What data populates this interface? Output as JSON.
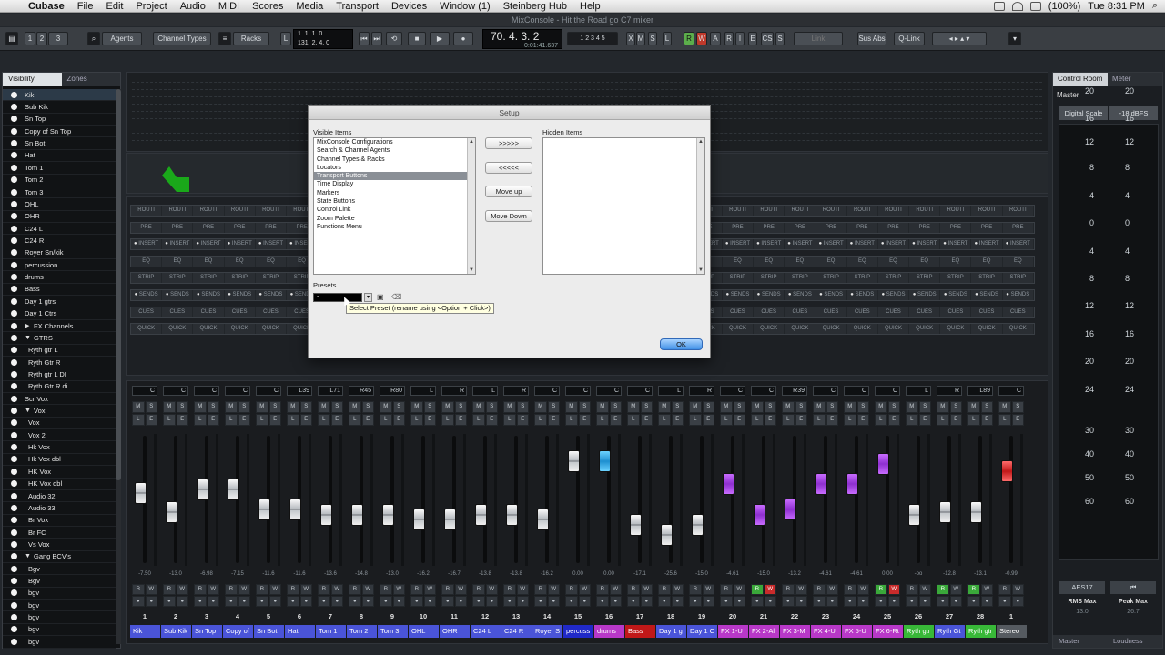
{
  "menubar": {
    "app": "Cubase",
    "items": [
      "File",
      "Edit",
      "Project",
      "Audio",
      "MIDI",
      "Scores",
      "Media",
      "Transport",
      "Devices",
      "Window (1)",
      "Steinberg Hub",
      "Help"
    ],
    "battery": "(100%)",
    "clock": "Tue 8:31 PM"
  },
  "window_title": "MixConsole - Hit the Road go C7 mixer",
  "toolbar": {
    "btn1": "1",
    "btn2": "2",
    "btn3": "3",
    "agents": "Agents",
    "channel_types": "Channel Types",
    "racks": "Racks",
    "time_line1": "1. 1. 1. 0",
    "time_line2": "131. 2. 4. 0",
    "position": "70. 4. 3. 2",
    "position_sub": "0:01:41.637",
    "sig": "1 2 3 4 5",
    "letters_a": [
      "X",
      "M",
      "S",
      "L"
    ],
    "letters_b": [
      "R",
      "W",
      "A"
    ],
    "letters_c": [
      "R",
      "I",
      "E",
      "CS",
      "S"
    ],
    "link": "Link",
    "sus_abs": "Sus Abs",
    "qlink": "Q-Link"
  },
  "left_panel": {
    "tabs": [
      "Visibility",
      "Zones"
    ],
    "items": [
      {
        "label": "Kik",
        "indent": 0,
        "sel": true
      },
      {
        "label": "Sub Kik",
        "indent": 0
      },
      {
        "label": "Sn Top",
        "indent": 0
      },
      {
        "label": "Copy of Sn Top",
        "indent": 0
      },
      {
        "label": "Sn Bot",
        "indent": 0
      },
      {
        "label": "Hat",
        "indent": 0
      },
      {
        "label": "Tom 1",
        "indent": 0
      },
      {
        "label": "Tom 2",
        "indent": 0
      },
      {
        "label": "Tom 3",
        "indent": 0
      },
      {
        "label": "OHL",
        "indent": 0
      },
      {
        "label": "OHR",
        "indent": 0
      },
      {
        "label": "C24 L",
        "indent": 0
      },
      {
        "label": "C24 R",
        "indent": 0
      },
      {
        "label": "Royer Sn/kik",
        "indent": 0
      },
      {
        "label": "percussion",
        "indent": 0
      },
      {
        "label": "drums",
        "indent": 0
      },
      {
        "label": "Bass",
        "indent": 0
      },
      {
        "label": "Day 1 gtrs",
        "indent": 0
      },
      {
        "label": "Day 1 Ctrs",
        "indent": 0
      },
      {
        "label": "FX Channels",
        "indent": 0,
        "folder": "closed"
      },
      {
        "label": "GTRS",
        "indent": 0,
        "folder": "open"
      },
      {
        "label": "Ryth gtr L",
        "indent": 1
      },
      {
        "label": "Ryth Gtr R",
        "indent": 1
      },
      {
        "label": "Ryth gtr L DI",
        "indent": 1
      },
      {
        "label": "Ryth Gtr R di",
        "indent": 1
      },
      {
        "label": "Scr Vox",
        "indent": 0
      },
      {
        "label": "Vox",
        "indent": 0,
        "folder": "open"
      },
      {
        "label": "Vox",
        "indent": 1
      },
      {
        "label": "Vox 2",
        "indent": 1
      },
      {
        "label": "Hk Vox",
        "indent": 1
      },
      {
        "label": "Hk Vox dbl",
        "indent": 1
      },
      {
        "label": "HK Vox",
        "indent": 1
      },
      {
        "label": "HK Vox dbl",
        "indent": 1
      },
      {
        "label": "Audio 32",
        "indent": 1
      },
      {
        "label": "Audio 33",
        "indent": 1
      },
      {
        "label": "Br Vox",
        "indent": 1
      },
      {
        "label": "Br FC",
        "indent": 1
      },
      {
        "label": "Vs Vox",
        "indent": 1
      },
      {
        "label": "Gang BCV's",
        "indent": 0,
        "folder": "open"
      },
      {
        "label": "Bgv",
        "indent": 1
      },
      {
        "label": "Bgv",
        "indent": 1
      },
      {
        "label": "bgv",
        "indent": 1
      },
      {
        "label": "bgv",
        "indent": 1
      },
      {
        "label": "bgv",
        "indent": 1
      },
      {
        "label": "bgv",
        "indent": 1
      },
      {
        "label": "bgv",
        "indent": 1
      }
    ]
  },
  "racks": {
    "rows": [
      {
        "label": "ROUTI",
        "on": false
      },
      {
        "label": "PRE",
        "on": false
      },
      {
        "label": "INSERT",
        "on": true
      },
      {
        "label": "EQ",
        "on": false
      },
      {
        "label": "STRIP",
        "on": false
      },
      {
        "label": "SENDS",
        "on": true
      },
      {
        "label": "CUES",
        "on": false
      },
      {
        "label": "QUICK",
        "on": false
      }
    ]
  },
  "dialog": {
    "title": "Setup",
    "visible_label": "Visible Items",
    "hidden_label": "Hidden Items",
    "visible_items": [
      "MixConsole Configurations",
      "Search & Channel Agents",
      "Channel Types & Racks",
      "Locators",
      "Transport Buttons",
      "Time Display",
      "Markers",
      "State Buttons",
      "Control Link",
      "Zoom Palette",
      "Functions Menu"
    ],
    "selected_index": 4,
    "btn_right": ">>>>>",
    "btn_left": "<<<<<",
    "btn_up": "Move up",
    "btn_down": "Move Down",
    "presets_label": "Presets",
    "preset_value": "-",
    "ok": "OK",
    "tooltip": "Select Preset (rename using <Option + Click>)"
  },
  "channels": [
    {
      "num": "1",
      "name": "Kik",
      "color": "#4a54d8",
      "pan": "C",
      "db": "-7.50",
      "fader": 0.55,
      "style": "white"
    },
    {
      "num": "2",
      "name": "Sub Kik",
      "color": "#4a54d8",
      "pan": "C",
      "db": "-13.0",
      "fader": 0.4,
      "style": "white"
    },
    {
      "num": "3",
      "name": "Sn Top",
      "color": "#4a54d8",
      "pan": "C",
      "db": "-6.98",
      "fader": 0.58,
      "style": "white"
    },
    {
      "num": "4",
      "name": "Copy of",
      "color": "#4a54d8",
      "pan": "C",
      "db": "-7.15",
      "fader": 0.58,
      "style": "white"
    },
    {
      "num": "5",
      "name": "Sn Bot",
      "color": "#4a54d8",
      "pan": "C",
      "db": "-11.6",
      "fader": 0.42,
      "style": "white"
    },
    {
      "num": "6",
      "name": "Hat",
      "color": "#4a54d8",
      "pan": "L39",
      "db": "-11.6",
      "fader": 0.42,
      "style": "white"
    },
    {
      "num": "7",
      "name": "Tom 1",
      "color": "#4a54d8",
      "pan": "L71",
      "db": "-13.6",
      "fader": 0.38,
      "style": "white"
    },
    {
      "num": "8",
      "name": "Tom 2",
      "color": "#4a54d8",
      "pan": "R45",
      "db": "-14.8",
      "fader": 0.38,
      "style": "white"
    },
    {
      "num": "9",
      "name": "Tom 3",
      "color": "#4a54d8",
      "pan": "R80",
      "db": "-13.0",
      "fader": 0.38,
      "style": "white"
    },
    {
      "num": "10",
      "name": "OHL",
      "color": "#4a54d8",
      "pan": "L",
      "db": "-16.2",
      "fader": 0.34,
      "style": "white"
    },
    {
      "num": "11",
      "name": "OHR",
      "color": "#4a54d8",
      "pan": "R",
      "db": "-16.7",
      "fader": 0.34,
      "style": "white"
    },
    {
      "num": "12",
      "name": "C24 L",
      "color": "#4a54d8",
      "pan": "L",
      "db": "-13.8",
      "fader": 0.38,
      "style": "white"
    },
    {
      "num": "13",
      "name": "C24 R",
      "color": "#4a54d8",
      "pan": "R",
      "db": "-13.8",
      "fader": 0.38,
      "style": "white"
    },
    {
      "num": "14",
      "name": "Royer S",
      "color": "#4a54d8",
      "pan": "C",
      "db": "-16.2",
      "fader": 0.34,
      "style": "white"
    },
    {
      "num": "15",
      "name": "percuss",
      "color": "#2029c8",
      "pan": "C",
      "db": "0.00",
      "fader": 0.8,
      "style": "white"
    },
    {
      "num": "16",
      "name": "drums",
      "color": "#b838c8",
      "pan": "C",
      "db": "0.00",
      "fader": 0.8,
      "style": "blue"
    },
    {
      "num": "17",
      "name": "Bass",
      "color": "#c01818",
      "pan": "C",
      "db": "-17.1",
      "fader": 0.3,
      "style": "white"
    },
    {
      "num": "18",
      "name": "Day 1 g",
      "color": "#4a54d8",
      "pan": "L",
      "db": "-25.6",
      "fader": 0.22,
      "style": "white"
    },
    {
      "num": "19",
      "name": "Day 1 C",
      "color": "#4a54d8",
      "pan": "R",
      "db": "-15.0",
      "fader": 0.3,
      "style": "white"
    },
    {
      "num": "20",
      "name": "FX 1-U",
      "color": "#b838c8",
      "pan": "C",
      "db": "-4.61",
      "fader": 0.62,
      "style": "purple"
    },
    {
      "num": "21",
      "name": "FX 2-Al",
      "color": "#b838c8",
      "pan": "C",
      "db": "-15.0",
      "fader": 0.38,
      "style": "purple"
    },
    {
      "num": "22",
      "name": "FX 3-M",
      "color": "#b838c8",
      "pan": "R39",
      "db": "-13.2",
      "fader": 0.42,
      "style": "purple"
    },
    {
      "num": "23",
      "name": "FX 4-U",
      "color": "#b838c8",
      "pan": "C",
      "db": "-4.61",
      "fader": 0.62,
      "style": "purple"
    },
    {
      "num": "24",
      "name": "FX 5-U",
      "color": "#b838c8",
      "pan": "C",
      "db": "-4.61",
      "fader": 0.62,
      "style": "purple"
    },
    {
      "num": "25",
      "name": "FX 6-Rt",
      "color": "#b838c8",
      "pan": "C",
      "db": "0.00",
      "fader": 0.78,
      "style": "purple"
    },
    {
      "num": "26",
      "name": "Ryth gtr",
      "color": "#38b838",
      "pan": "L",
      "db": "-oo",
      "fader": 0.38,
      "style": "white"
    },
    {
      "num": "27",
      "name": "Ryth Gt",
      "color": "#4a54d8",
      "pan": "R",
      "db": "-12.8",
      "fader": 0.4,
      "style": "white"
    },
    {
      "num": "28",
      "name": "Ryth gtr",
      "color": "#38b838",
      "pan": "L89",
      "db": "-13.1",
      "fader": 0.4,
      "style": "white"
    },
    {
      "num": "1",
      "name": "Stereo",
      "color": "#555a60",
      "pan": "C",
      "db": "-0.99",
      "fader": 0.72,
      "style": "red"
    }
  ],
  "right_panel": {
    "tabs": [
      "Control Room",
      "Meter"
    ],
    "master": "Master",
    "digital_scale": "Digital Scale",
    "dbfs": "-18 dBFS",
    "scale": [
      "20",
      "16",
      "12",
      "8",
      "4",
      "0",
      "4",
      "8",
      "12",
      "16",
      "20",
      "24",
      "30",
      "40",
      "50",
      "60"
    ],
    "aes": "AES17",
    "skip": "⏮",
    "rms_label": "RMS Max",
    "rms_val": "13.0",
    "peak_label": "Peak Max",
    "peak_val": "26.7",
    "bottom_tabs": [
      "Master",
      "Loudness"
    ]
  },
  "colors": {
    "accent": "#3f8fe6",
    "green_meter": "#1aa81a"
  }
}
